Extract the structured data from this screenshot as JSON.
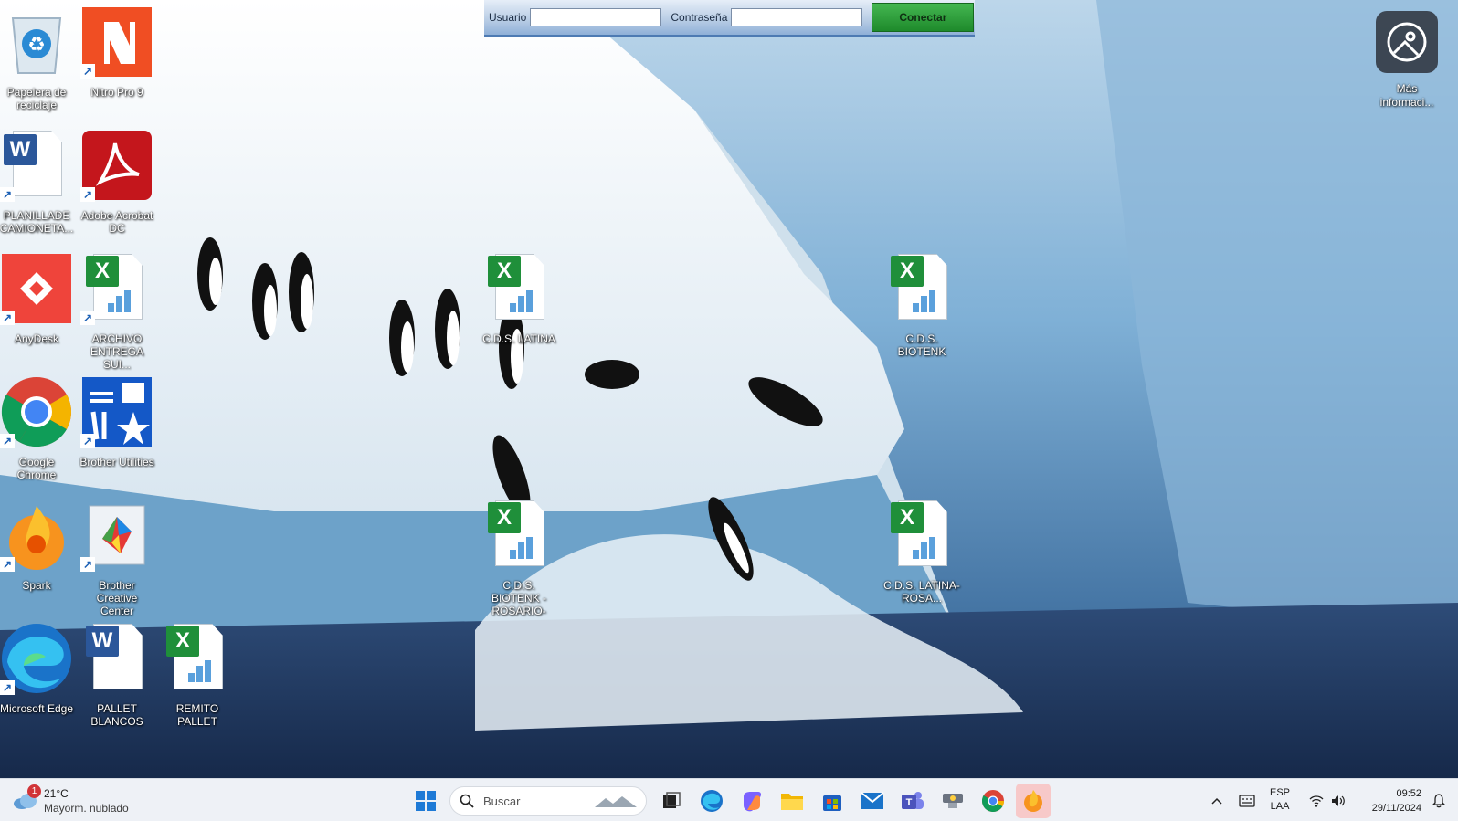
{
  "desktop": {
    "icons": [
      {
        "label": "Papelera de reciclaje",
        "icon": "recycle-bin-icon"
      },
      {
        "label": "Nitro Pro 9",
        "icon": "nitro-pdf-icon"
      },
      {
        "label": "PLANILLADE CAMIONETA...",
        "icon": "word-document-icon"
      },
      {
        "label": "Adobe Acrobat DC",
        "icon": "adobe-acrobat-icon"
      },
      {
        "label": "AnyDesk",
        "icon": "anydesk-icon"
      },
      {
        "label": "ARCHIVO ENTREGA SUI...",
        "icon": "excel-document-icon"
      },
      {
        "label": "Google Chrome",
        "icon": "chrome-icon"
      },
      {
        "label": "Brother Utilities",
        "icon": "brother-utilities-icon"
      },
      {
        "label": "Spark",
        "icon": "spark-icon"
      },
      {
        "label": "Brother Creative Center",
        "icon": "brother-creative-icon"
      },
      {
        "label": "Microsoft Edge",
        "icon": "edge-icon"
      },
      {
        "label": "PALLET BLANCOS",
        "icon": "word-document-icon"
      },
      {
        "label": "REMITO PALLET",
        "icon": "excel-document-icon"
      },
      {
        "label": "C.D.S. LATINA",
        "icon": "excel-document-icon"
      },
      {
        "label": "C.D.S. BIOTENK",
        "icon": "excel-document-icon"
      },
      {
        "label": "C.D.S. BIOTENK -ROSARIO-",
        "icon": "excel-document-icon"
      },
      {
        "label": "C.D.S. LATINA-ROSA...",
        "icon": "excel-document-icon"
      }
    ],
    "more_info": {
      "label": "Más informaci...",
      "icon": "spotlight-info-icon"
    }
  },
  "login_bar": {
    "user_label": "Usuario",
    "user_value": "",
    "password_label": "Contraseña",
    "password_value": "",
    "connect_label": "Conectar"
  },
  "taskbar": {
    "weather": {
      "temperature": "21°C",
      "condition": "Mayorm. nublado",
      "badge": "1"
    },
    "search_placeholder": "Buscar",
    "apps": [
      "start-icon",
      "task-view-icon",
      "edge-icon",
      "copilot-icon",
      "file-explorer-icon",
      "store-icon",
      "mail-icon",
      "teams-icon",
      "network-app-icon",
      "chrome-icon",
      "spark-icon"
    ],
    "language": {
      "line1": "ESP",
      "line2": "LAA"
    },
    "clock": {
      "time": "09:52",
      "date": "29/11/2024"
    }
  },
  "colors": {
    "taskbar_bg": "#eef1f6",
    "connect_button": "#1e8a2b",
    "active_app": "#f7c9c9"
  }
}
